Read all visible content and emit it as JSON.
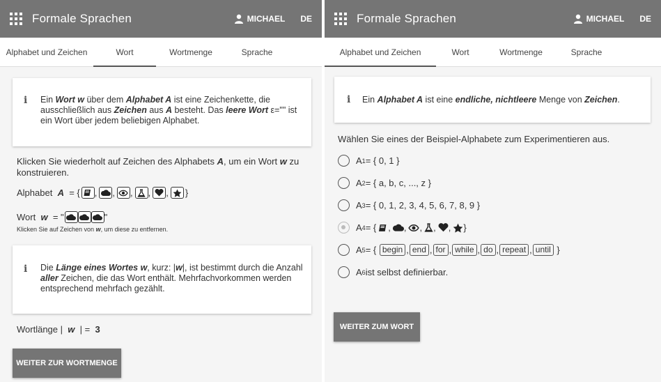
{
  "app": {
    "title": "Formale Sprachen",
    "user": "MICHAEL",
    "lang": "DE"
  },
  "tabs": [
    "Alphabet und Zeichen",
    "Wort",
    "Wortmenge",
    "Sprache"
  ],
  "left": {
    "active_tab": "Wort",
    "info1": {
      "p1": "Ein ",
      "w1": "Wort w",
      "p2": " über dem ",
      "w2": "Alphabet A",
      "p3": " ist eine Zeichenkette, die ausschließlich aus ",
      "w3": "Zeichen",
      "p4": " aus ",
      "w4": "A",
      "p5": " besteht. Das ",
      "w5": "leere Wort",
      "p6": " ε=\"\" ist ein Wort über jedem beliebigen Alphabet."
    },
    "instruction_pre": "Klicken Sie wiederholt auf Zeichen des Alphabets ",
    "instruction_A": "A",
    "instruction_mid": ", um ein Wort ",
    "instruction_w": "w",
    "instruction_post": " zu konstruieren.",
    "alphabet_label": "Alphabet",
    "alphabet_var": "A",
    "alphabet_eq": "= {",
    "alphabet_close": "}",
    "alphabet_symbols": [
      "book-icon",
      "cloud-icon",
      "eye-icon",
      "flask-icon",
      "heart-icon",
      "star-icon"
    ],
    "word_label": "Wort",
    "word_var": "w",
    "word_eq": "= \"",
    "word_close": "\"",
    "word_symbols": [
      "cloud-icon",
      "cloud-icon",
      "cloud-icon"
    ],
    "hint_pre": "Klicken Sie auf Zeichen von ",
    "hint_w": "w",
    "hint_post": ", um diese zu entfernen.",
    "info2": {
      "p1": "Die ",
      "w1": "Länge eines Wortes w",
      "p2": ", kurz: |",
      "w2": "w",
      "p3": "|, ist bestimmt durch die Anzahl ",
      "w3": "aller",
      "p4": " Zeichen, die das Wort enthält. Mehrfachvorkommen werden entsprechend mehrfach gezählt."
    },
    "length_label": "Wortlänge |",
    "length_var": "w",
    "length_eq": "| =",
    "length_value": "3",
    "next_button": "WEITER ZUR WORTMENGE"
  },
  "right": {
    "active_tab": "Alphabet und Zeichen",
    "info": {
      "p1": "Ein ",
      "w1": "Alphabet A",
      "p2": " ist eine ",
      "w2": "endliche, nichtleere",
      "p3": " Menge von ",
      "w3": "Zeichen",
      "p4": "."
    },
    "choose_text": "Wählen Sie eines der Beispiel-Alphabete zum Experimentieren aus.",
    "options": [
      {
        "name": "A",
        "sub": "1",
        "text": " = { 0, 1 }",
        "selected": false
      },
      {
        "name": "A",
        "sub": "2",
        "text": " = { a, b, c, ..., z }",
        "selected": false
      },
      {
        "name": "A",
        "sub": "3",
        "text": " = { 0, 1, 2, 3, 4, 5, 6, 7, 8, 9 }",
        "selected": false
      },
      {
        "name": "A",
        "sub": "4",
        "text": " = {",
        "selected": true
      },
      {
        "name": "A",
        "sub": "5",
        "text": " = {",
        "selected": false
      },
      {
        "name": "A",
        "sub": "6",
        "text": " ist selbst definierbar.",
        "selected": false
      }
    ],
    "a5_keywords": [
      "begin",
      "end",
      "for",
      "while",
      "do",
      "repeat",
      "until"
    ],
    "next_button": "WEITER ZUM WORT"
  }
}
